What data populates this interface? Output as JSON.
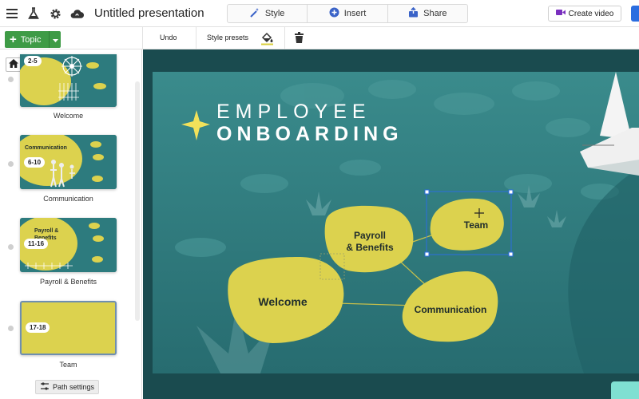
{
  "header": {
    "title": "Untitled presentation",
    "tabs": [
      {
        "label": "Style",
        "icon": "wand-icon"
      },
      {
        "label": "Insert",
        "icon": "plus-circle-icon"
      },
      {
        "label": "Share",
        "icon": "share-upload-icon"
      }
    ],
    "create_video_label": "Create video"
  },
  "toolbar": {
    "topic_label": "Topic",
    "undo_label": "Undo",
    "style_presets_label": "Style presets"
  },
  "sidebar": {
    "thumbnails": [
      {
        "badge": "2-5",
        "label": "Welcome"
      },
      {
        "badge": "6-10",
        "label": "Communication",
        "inner_text": "Communication"
      },
      {
        "badge": "11-16",
        "label": "Payroll & Benefits",
        "inner_text": "Payroll & Benefits"
      },
      {
        "badge": "17-18",
        "label": "Team"
      }
    ],
    "path_settings_label": "Path settings"
  },
  "slide": {
    "title_line1": "EMPLOYEE",
    "title_line2": "ONBOARDING",
    "bubbles": {
      "team": "Team",
      "payroll_line1": "Payroll",
      "payroll_line2": "& Benefits",
      "welcome": "Welcome",
      "communication": "Communication"
    }
  },
  "colors": {
    "teal_bg": "#2f7a7d",
    "bubble_yellow": "#dcd24e",
    "topic_green": "#3e9b46",
    "selection_blue": "#2b6de0"
  }
}
